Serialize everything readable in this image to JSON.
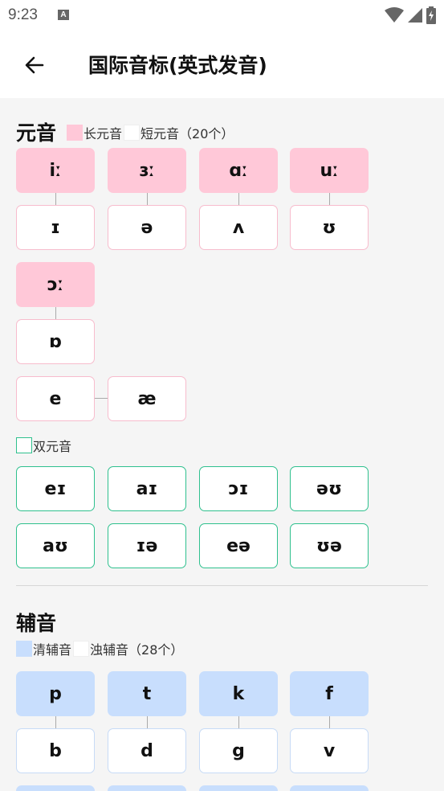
{
  "status": {
    "time": "9:23",
    "notif_icon": "A"
  },
  "appbar": {
    "title": "国际音标(英式发音)",
    "back_icon": "arrow-left-icon"
  },
  "vowels": {
    "title": "元音",
    "legend": {
      "long_label": "长元音",
      "short_label": "短元音（20个）"
    },
    "pairs": [
      {
        "long": "iː",
        "short": "ɪ"
      },
      {
        "long": "ɜː",
        "short": "ə"
      },
      {
        "long": "ɑː",
        "short": "ʌ"
      },
      {
        "long": "uː",
        "short": "ʊ"
      },
      {
        "long": "ɔː",
        "short": "ɒ"
      }
    ],
    "extra_pair": [
      "e",
      "æ"
    ],
    "diphthong_label": "双元音",
    "diphthongs": [
      "eɪ",
      "aɪ",
      "ɔɪ",
      "əʊ",
      "aʊ",
      "ɪə",
      "eə",
      "ʊə"
    ]
  },
  "consonants": {
    "title": "辅音",
    "legend": {
      "voiceless_label": "清辅音",
      "voiced_label": "浊辅音（28个）"
    },
    "pairs": [
      {
        "voiceless": "p",
        "voiced": "b"
      },
      {
        "voiceless": "t",
        "voiced": "d"
      },
      {
        "voiceless": "k",
        "voiced": "g"
      },
      {
        "voiceless": "f",
        "voiced": "v"
      }
    ]
  },
  "colors": {
    "long_vowel": "#ffc8d8",
    "short_vowel_border": "#f7bccd",
    "diphthong_border": "#2fc08e",
    "voiceless": "#c8defd",
    "voiced_border": "#c7dbf6"
  }
}
